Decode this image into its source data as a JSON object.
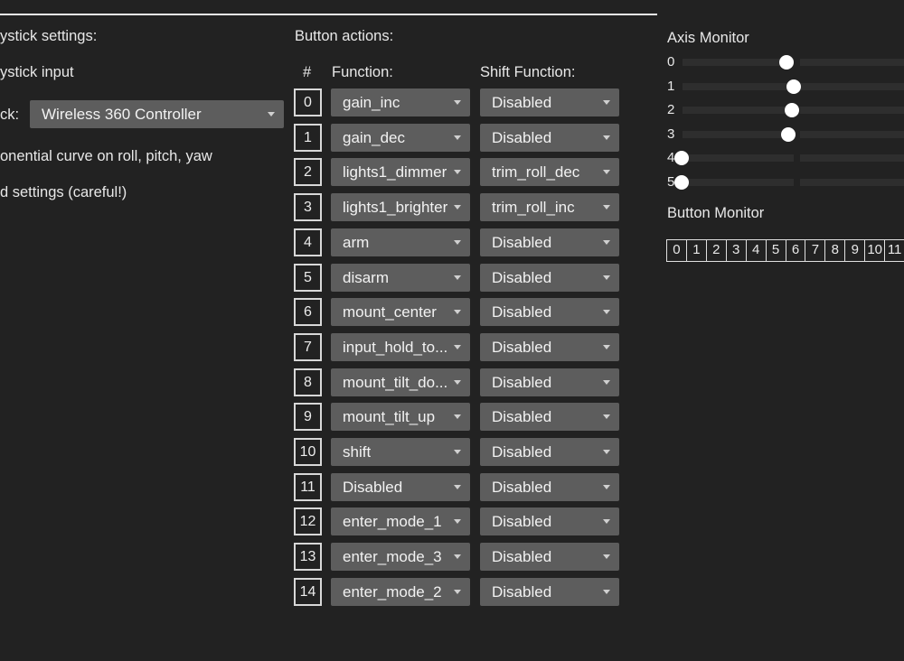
{
  "left_panel": {
    "heading": "ystick settings:",
    "joystick_input_label": "ystick input",
    "joystick_field_label": "ck:",
    "joystick_value": "Wireless 360 Controller",
    "expo_label": "onential curve on roll, pitch, yaw",
    "advanced_label": "d settings (careful!)"
  },
  "button_actions": {
    "heading": "Button actions:",
    "col_index": "#",
    "col_function": "Function:",
    "col_shift": "Shift Function:",
    "rows": [
      {
        "index": "0",
        "function": "gain_inc",
        "shift": "Disabled"
      },
      {
        "index": "1",
        "function": "gain_dec",
        "shift": "Disabled"
      },
      {
        "index": "2",
        "function": "lights1_dimmer",
        "shift": "trim_roll_dec"
      },
      {
        "index": "3",
        "function": "lights1_brighter",
        "shift": "trim_roll_inc"
      },
      {
        "index": "4",
        "function": "arm",
        "shift": "Disabled"
      },
      {
        "index": "5",
        "function": "disarm",
        "shift": "Disabled"
      },
      {
        "index": "6",
        "function": "mount_center",
        "shift": "Disabled"
      },
      {
        "index": "7",
        "function": "input_hold_to...",
        "shift": "Disabled"
      },
      {
        "index": "8",
        "function": "mount_tilt_do...",
        "shift": "Disabled"
      },
      {
        "index": "9",
        "function": "mount_tilt_up",
        "shift": "Disabled"
      },
      {
        "index": "10",
        "function": "shift",
        "shift": "Disabled"
      },
      {
        "index": "11",
        "function": "Disabled",
        "shift": "Disabled"
      },
      {
        "index": "12",
        "function": "enter_mode_1",
        "shift": "Disabled"
      },
      {
        "index": "13",
        "function": "enter_mode_3",
        "shift": "Disabled"
      },
      {
        "index": "14",
        "function": "enter_mode_2",
        "shift": "Disabled"
      }
    ]
  },
  "axis_monitor": {
    "heading": "Axis Monitor",
    "axes": [
      {
        "label": "0",
        "value": 0.0
      },
      {
        "label": "1",
        "value": 0.07
      },
      {
        "label": "2",
        "value": 0.05
      },
      {
        "label": "3",
        "value": 0.02
      },
      {
        "label": "4",
        "value": -1.0
      },
      {
        "label": "5",
        "value": -1.0
      }
    ]
  },
  "button_monitor": {
    "heading": "Button Monitor",
    "buttons": [
      "0",
      "1",
      "2",
      "3",
      "4",
      "5",
      "6",
      "7",
      "8",
      "9",
      "10",
      "11"
    ]
  },
  "colors": {
    "background": "#222222",
    "combo": "#5d5d5d",
    "text": "#e8e8e8",
    "knob": "#ffffff"
  }
}
